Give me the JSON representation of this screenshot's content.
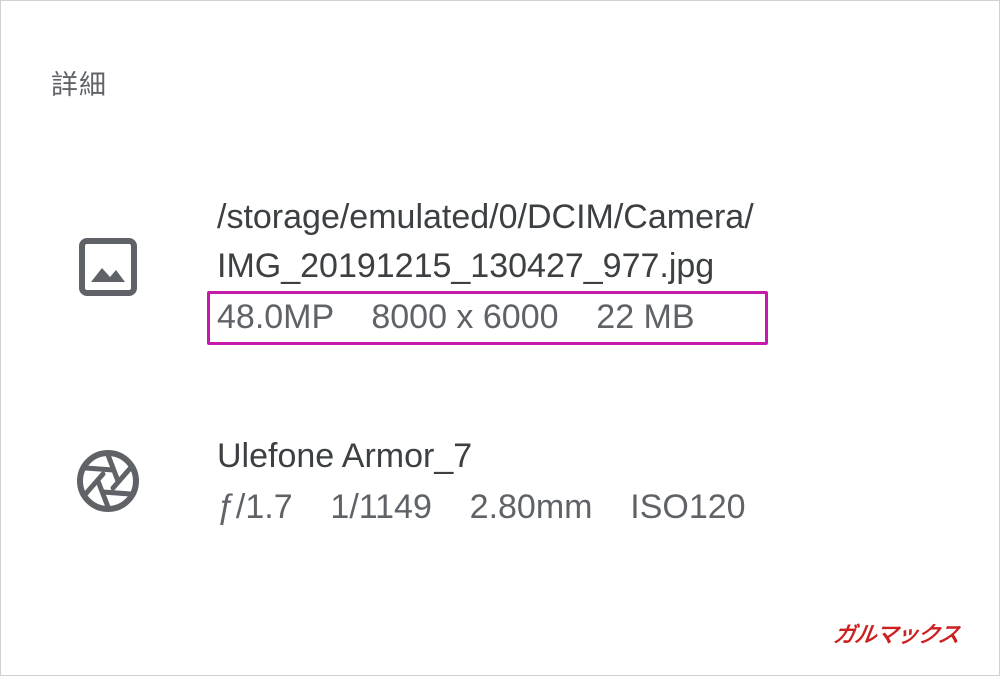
{
  "section_title": "詳細",
  "image_info": {
    "icon": "image-icon",
    "path_line1": "/storage/emulated/0/DCIM/Camera/",
    "path_line2": "IMG_20191215_130427_977.jpg",
    "details": "48.0MP    8000 x 6000    22 MB"
  },
  "camera_info": {
    "icon": "aperture-icon",
    "model": "Ulefone Armor_7",
    "details": "ƒ/1.7    1/1149    2.80mm    ISO120"
  },
  "watermark": "ガルマックス",
  "colors": {
    "icon": "#5f6368",
    "primary_text": "#3c4043",
    "secondary_text": "#5f6368",
    "highlight": "#c61ba9",
    "watermark": "#cc2020"
  }
}
